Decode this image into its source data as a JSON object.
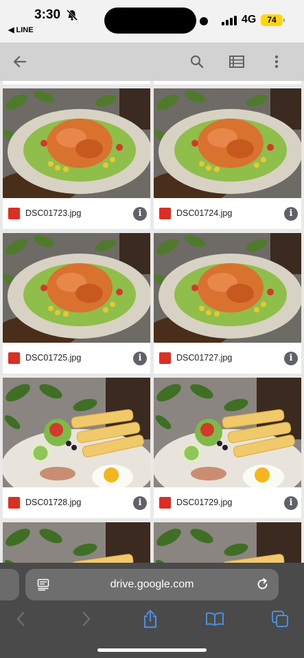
{
  "status_bar": {
    "time": "3:30",
    "back_app": "◀ LINE",
    "network": "4G",
    "battery": "74"
  },
  "toolbar": {
    "back_icon": "arrow-left-icon",
    "search_icon": "search-icon",
    "list_view_icon": "list-view-icon",
    "more_icon": "more-vert-icon"
  },
  "files": [
    {
      "name": "DSC01723.jpg",
      "photo": "salad"
    },
    {
      "name": "DSC01724.jpg",
      "photo": "salad"
    },
    {
      "name": "DSC01725.jpg",
      "photo": "salad"
    },
    {
      "name": "DSC01727.jpg",
      "photo": "salad"
    },
    {
      "name": "DSC01728.jpg",
      "photo": "breakfast"
    },
    {
      "name": "DSC01729.jpg",
      "photo": "breakfast"
    }
  ],
  "browser": {
    "url": "drive.google.com"
  },
  "colors": {
    "toolbar_bg": "#d2d2d2",
    "image_file_icon": "#d93025",
    "browser_bar": "#4a4a4a",
    "ios_blue": "#4a90e2"
  }
}
